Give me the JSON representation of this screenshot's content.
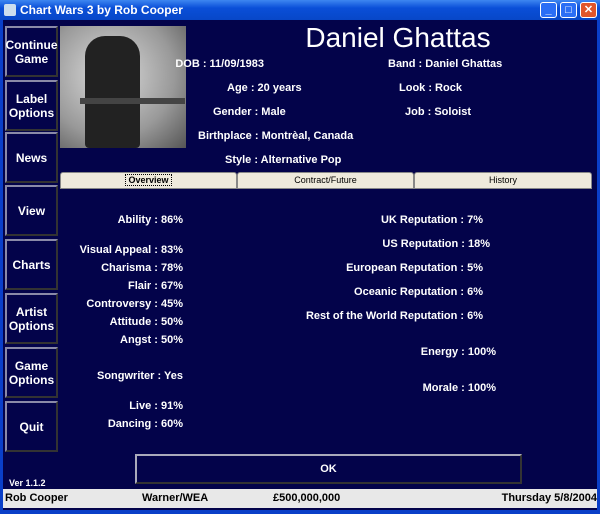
{
  "window": {
    "title": "Chart Wars 3 by Rob Cooper",
    "min": "_",
    "max": "□",
    "close": "✕"
  },
  "sidebar": [
    {
      "label": "Continue Game"
    },
    {
      "label": "Label Options"
    },
    {
      "label": "News"
    },
    {
      "label": "View"
    },
    {
      "label": "Charts"
    },
    {
      "label": "Artist Options"
    },
    {
      "label": "Game Options"
    },
    {
      "label": "Quit"
    }
  ],
  "artist": {
    "name": "Daniel Ghattas",
    "dob": "DOB : 11/09/1983",
    "age": "Age : 20 years",
    "gender": "Gender : Male",
    "birthplace": "Birthplace : Montrèal, Canada",
    "style": "Style : Alternative Pop",
    "band": "Band : Daniel Ghattas",
    "look": "Look : Rock",
    "job": "Job : Soloist"
  },
  "tabs": [
    {
      "label": "Overview"
    },
    {
      "label": "Contract/Future"
    },
    {
      "label": "History"
    }
  ],
  "stats_left": [
    "Ability : 86%",
    "Visual Appeal : 83%",
    "Charisma : 78%",
    "Flair : 67%",
    "Controversy : 45%",
    "Attitude : 50%",
    "Angst : 50%",
    "Songwriter : Yes",
    "Live : 91%",
    "Dancing : 60%"
  ],
  "stats_right": [
    "UK Reputation : 7%",
    "US Reputation : 18%",
    "European Reputation : 5%",
    "Oceanic Reputation : 6%",
    "Rest of the World Reputation : 6%",
    "Energy : 100%",
    "Morale : 100%"
  ],
  "ok_label": "OK",
  "version": "Ver 1.1.2",
  "status": {
    "player": "Rob Cooper",
    "label": "Warner/WEA",
    "money": "£500,000,000",
    "date": "Thursday 5/8/2004"
  }
}
